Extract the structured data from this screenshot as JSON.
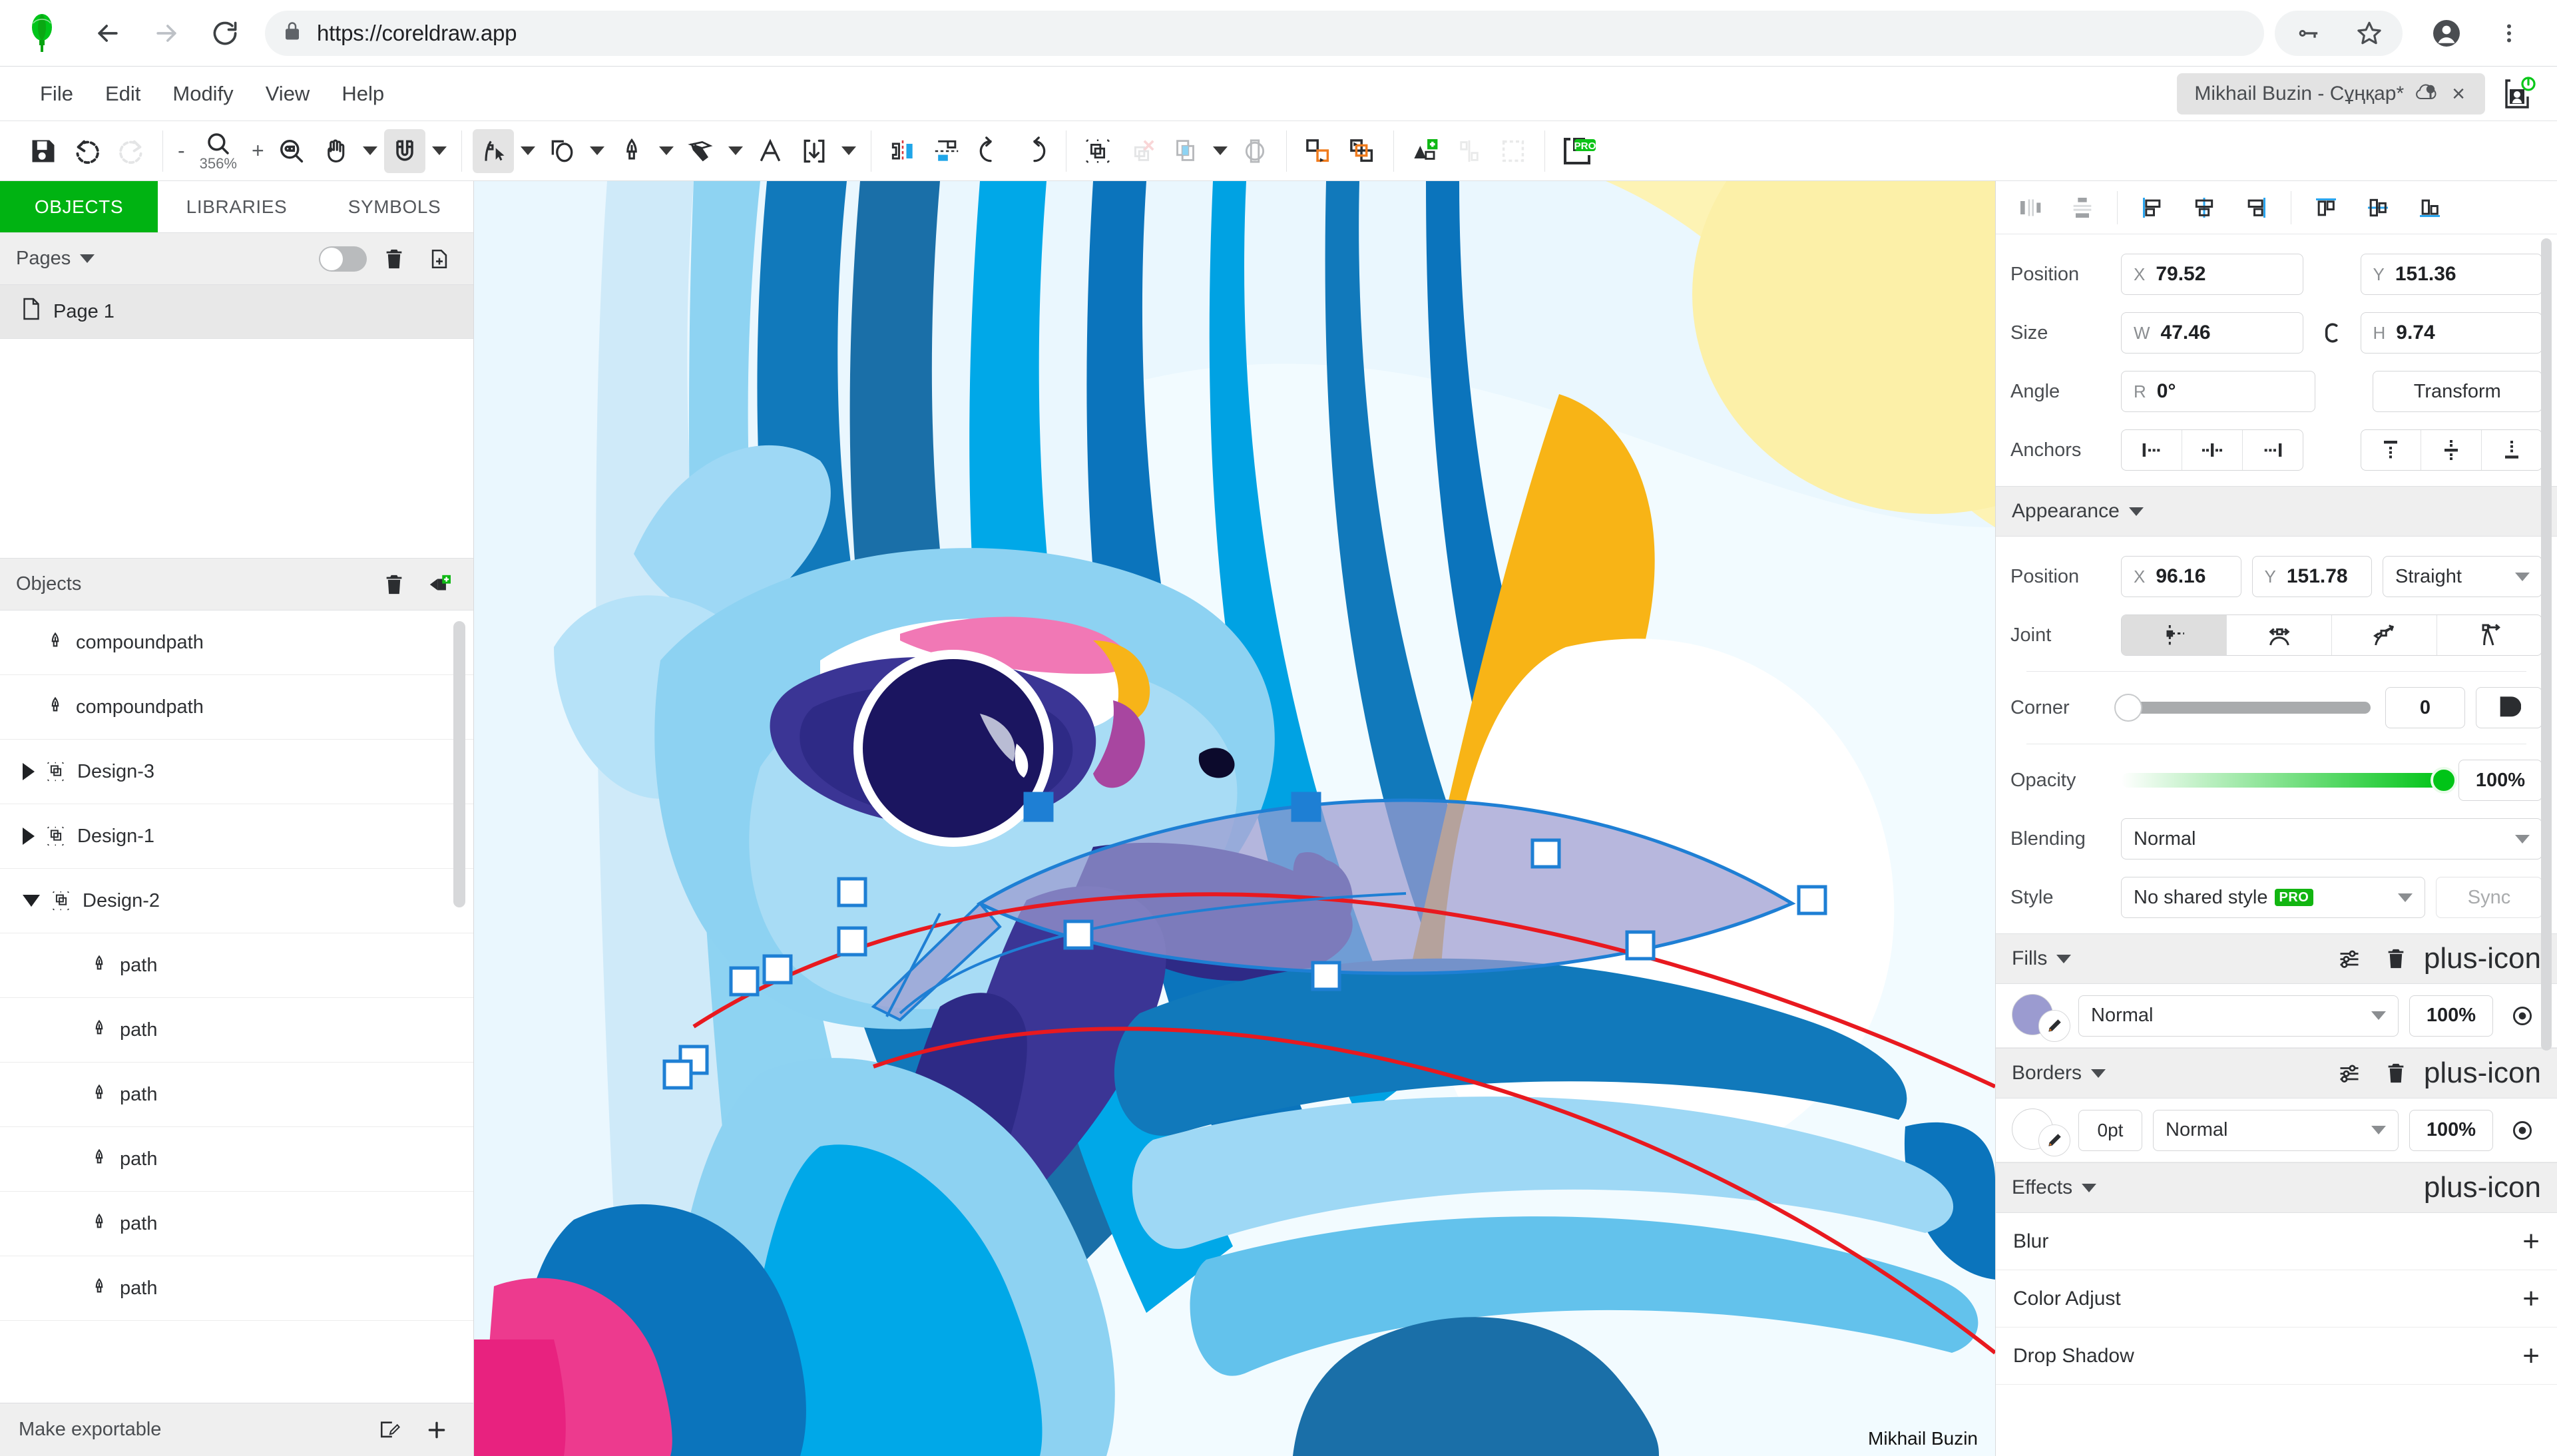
{
  "browser": {
    "url": "https://coreldraw.app",
    "icons": {
      "back": "back-arrow-icon",
      "forward": "forward-arrow-icon",
      "reload": "reload-icon",
      "lock": "lock-icon",
      "key": "key-icon",
      "bookmark": "star-icon",
      "account": "account-avatar-icon",
      "menu": "kebab-menu-icon"
    }
  },
  "app_header": {
    "menus": [
      "File",
      "Edit",
      "Modify",
      "View",
      "Help"
    ],
    "document_tab": {
      "title": "Mikhail Buzin - Сұңқар*",
      "cloud_icon": "cloud-sync-icon",
      "close": "×"
    },
    "account_button": "sign-out-account-icon"
  },
  "toolbar": {
    "zoom_level": "356%",
    "zoom_out": "-",
    "zoom_in": "+",
    "pro_badge": "PRO",
    "tools": [
      {
        "name": "save-icon",
        "active": false
      },
      {
        "name": "undo-icon",
        "active": false
      },
      {
        "name": "redo-icon",
        "active": false,
        "disabled": true
      },
      {
        "name": "zoom-tool-icon",
        "active": false
      },
      {
        "name": "hand-tool-icon",
        "active": false
      },
      {
        "name": "snap-magnet-icon",
        "active": true
      },
      {
        "name": "node-edit-tool-icon",
        "active": true
      },
      {
        "name": "shape-tool-icon",
        "active": false
      },
      {
        "name": "pen-tool-icon",
        "active": false
      },
      {
        "name": "eraser-knife-icon",
        "active": false
      },
      {
        "name": "text-tool-icon",
        "active": false
      },
      {
        "name": "import-icon",
        "active": false
      },
      {
        "name": "flip-horizontal-icon",
        "active": false
      },
      {
        "name": "flip-vertical-icon",
        "active": false
      },
      {
        "name": "rotate-left-icon",
        "active": false
      },
      {
        "name": "rotate-right-icon",
        "active": false
      },
      {
        "name": "group-icon",
        "active": false
      },
      {
        "name": "ungroup-icon",
        "active": false,
        "disabled": true
      },
      {
        "name": "combine-icon",
        "active": false
      },
      {
        "name": "intersect-icon",
        "active": false
      },
      {
        "name": "bring-forward-icon",
        "active": false
      },
      {
        "name": "send-backward-icon",
        "active": false
      },
      {
        "name": "convert-to-curves-icon",
        "active": false
      },
      {
        "name": "simplify-path-icon",
        "active": false,
        "disabled": true
      },
      {
        "name": "marquee-select-icon",
        "active": false,
        "disabled": true
      },
      {
        "name": "export-pro-icon",
        "active": false
      }
    ]
  },
  "left_panel": {
    "tabs": [
      {
        "label": "OBJECTS",
        "active": true
      },
      {
        "label": "LIBRARIES",
        "active": false
      },
      {
        "label": "SYMBOLS",
        "active": false
      }
    ],
    "pages_section": {
      "title": "Pages",
      "toggle_on": false,
      "delete_icon": "trash-icon",
      "add_icon": "add-page-icon",
      "pages": [
        {
          "label": "Page 1",
          "selected": true
        }
      ]
    },
    "objects_section": {
      "title": "Objects",
      "delete_icon": "trash-icon",
      "add_layer_icon": "add-layer-icon",
      "items": [
        {
          "label": "compoundpath",
          "icon": "pen-nib-icon",
          "indent": 0,
          "expander": "none"
        },
        {
          "label": "compoundpath",
          "icon": "pen-nib-icon",
          "indent": 0,
          "expander": "none"
        },
        {
          "label": "Design-3",
          "icon": "group-object-icon",
          "indent": 0,
          "expander": "closed"
        },
        {
          "label": "Design-1",
          "icon": "group-object-icon",
          "indent": 0,
          "expander": "closed"
        },
        {
          "label": "Design-2",
          "icon": "group-object-icon",
          "indent": 0,
          "expander": "open"
        },
        {
          "label": "path",
          "icon": "pen-nib-icon",
          "indent": 1,
          "expander": "none"
        },
        {
          "label": "path",
          "icon": "pen-nib-icon",
          "indent": 1,
          "expander": "none"
        },
        {
          "label": "path",
          "icon": "pen-nib-icon",
          "indent": 1,
          "expander": "none"
        },
        {
          "label": "path",
          "icon": "pen-nib-icon",
          "indent": 1,
          "expander": "none"
        },
        {
          "label": "path",
          "icon": "pen-nib-icon",
          "indent": 1,
          "expander": "none"
        },
        {
          "label": "path",
          "icon": "pen-nib-icon",
          "indent": 1,
          "expander": "none"
        }
      ]
    },
    "footer": {
      "label": "Make exportable",
      "edit_icon": "export-edit-icon",
      "add_icon": "plus-icon"
    }
  },
  "canvas": {
    "watermark": "Mikhail Buzin",
    "artwork_title": "stylized falcon illustration",
    "selection": {
      "fill_color": "#9b9bd0",
      "outline_color": "#1e7fd4",
      "guide_color": "#e8191f",
      "node_count": 12
    }
  },
  "right_panel": {
    "align_buttons": [
      "distribute-horizontal-icon",
      "distribute-vertical-icon",
      "align-left-icon",
      "align-center-horizontal-icon",
      "align-right-icon",
      "align-top-icon",
      "align-middle-vertical-icon",
      "align-bottom-icon"
    ],
    "transform": {
      "position_label": "Position",
      "position_x_key": "X",
      "position_x": "79.52",
      "position_y_key": "Y",
      "position_y": "151.36",
      "size_label": "Size",
      "width_key": "W",
      "width": "47.46",
      "height_key": "H",
      "height": "9.74",
      "link_icon": "link-aspect-icon",
      "angle_label": "Angle",
      "angle_key": "R",
      "angle": "0°",
      "transform_button": "Transform",
      "anchors_label": "Anchors",
      "anchor_h": [
        "anchor-left-icon",
        "anchor-center-icon",
        "anchor-right-icon"
      ],
      "anchor_v": [
        "anchor-top-icon",
        "anchor-middle-icon",
        "anchor-bottom-icon"
      ]
    },
    "appearance": {
      "title": "Appearance",
      "node_position_label": "Position",
      "node_x_key": "X",
      "node_x": "96.16",
      "node_y_key": "Y",
      "node_y": "151.78",
      "node_type": "Straight",
      "joint_label": "Joint",
      "joints": [
        {
          "icon": "joint-cusp-icon",
          "active": true
        },
        {
          "icon": "joint-symmetric-icon",
          "active": false
        },
        {
          "icon": "joint-smooth-icon",
          "active": false
        },
        {
          "icon": "joint-asymmetric-icon",
          "active": false
        }
      ],
      "corner_label": "Corner",
      "corner_value": "0",
      "corner_style_icon": "corner-round-icon",
      "opacity_label": "Opacity",
      "opacity_value": "100%",
      "blending_label": "Blending",
      "blending_value": "Normal",
      "style_label": "Style",
      "style_value": "No shared style",
      "style_pro_badge": "PRO",
      "sync_button": "Sync"
    },
    "fills": {
      "title": "Fills",
      "settings_icon": "sliders-icon",
      "delete_icon": "trash-icon",
      "add_icon": "plus-icon",
      "rows": [
        {
          "color": "#9b9bd0",
          "dropper_icon": "eyedropper-icon",
          "blend_mode": "Normal",
          "opacity": "100%",
          "visibility_icon": "eye-icon"
        }
      ]
    },
    "borders": {
      "title": "Borders",
      "settings_icon": "sliders-icon",
      "delete_icon": "trash-icon",
      "add_icon": "plus-icon",
      "rows": [
        {
          "color": "#ffffff",
          "dropper_icon": "eyedropper-icon",
          "width": "0pt",
          "blend_mode": "Normal",
          "opacity": "100%",
          "visibility_icon": "eye-icon"
        }
      ]
    },
    "effects": {
      "title": "Effects",
      "add_icon": "plus-icon",
      "items": [
        {
          "label": "Blur",
          "add": "+"
        },
        {
          "label": "Color Adjust",
          "add": "+"
        },
        {
          "label": "Drop Shadow",
          "add": "+"
        }
      ]
    }
  },
  "colors": {
    "accent_green": "#00b312",
    "panel_grey": "#efefef",
    "selection_blue": "#1e7fd4",
    "guide_red": "#e8191f",
    "fill_lavender": "#9b9bd0"
  }
}
